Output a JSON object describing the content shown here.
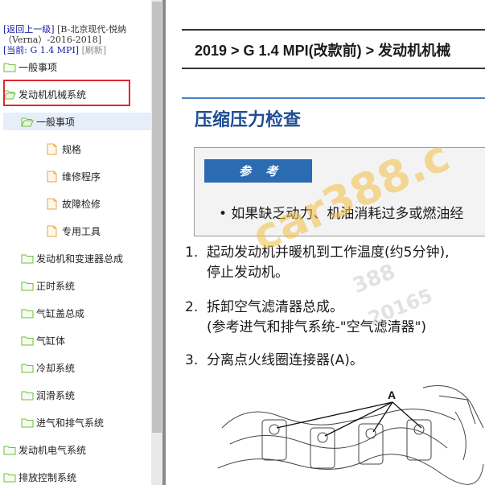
{
  "sidebar": {
    "header": {
      "back_link": "[返回上一级]",
      "model_line": "[B-北京现代-悦纳（Verna）-2016-2018]",
      "current_label": "[当前:",
      "current_value": "G 1.4 MPI]",
      "refresh": "[刷新]"
    },
    "tree": [
      {
        "label": "一般事项",
        "icon": "folder-icon"
      },
      {
        "label": "发动机机械系统",
        "icon": "folder-open-icon"
      },
      {
        "label": "一般事项",
        "icon": "folder-open-icon"
      },
      {
        "label": "规格",
        "icon": "page-icon"
      },
      {
        "label": "维修程序",
        "icon": "page-icon"
      },
      {
        "label": "故障检修",
        "icon": "page-icon"
      },
      {
        "label": "专用工具",
        "icon": "page-icon"
      },
      {
        "label": "发动机和变速器总成",
        "icon": "folder-icon"
      },
      {
        "label": "正时系统",
        "icon": "folder-icon"
      },
      {
        "label": "气缸盖总成",
        "icon": "folder-icon"
      },
      {
        "label": "气缸体",
        "icon": "folder-icon"
      },
      {
        "label": "冷却系统",
        "icon": "folder-icon"
      },
      {
        "label": "润滑系统",
        "icon": "folder-icon"
      },
      {
        "label": "进气和排气系统",
        "icon": "folder-icon"
      },
      {
        "label": "发动机电气系统",
        "icon": "folder-icon"
      },
      {
        "label": "排放控制系统",
        "icon": "folder-icon"
      }
    ]
  },
  "content": {
    "breadcrumb": "2019 > G 1.4 MPI(改款前) > 发动机机械",
    "title": "压缩压力检查",
    "note_button": "参考",
    "note_text": "• 如果缺乏动力、机油消耗过多或燃油经",
    "steps": [
      {
        "number": "1.",
        "line1": "起动发动机并暖机到工作温度(约5分钟),",
        "line2": "停止发动机。"
      },
      {
        "number": "2.",
        "line1": "拆卸空气滤清器总成。",
        "line2": "(参考进气和排气系统-\"空气滤清器\")"
      },
      {
        "number": "3.",
        "line1": "分离点火线圈连接器(A)。",
        "line2": ""
      }
    ],
    "figure_label": "A"
  },
  "watermark": {
    "main": "car388.c",
    "sub1": "388",
    "sub2": "20165"
  },
  "colors": {
    "link": "#1a1aa6",
    "title_blue": "#1f4e93",
    "note_button": "#2b6bb2",
    "highlight_box": "#e0282e",
    "folder": "#6fbf3a",
    "page": "#e8a64a"
  }
}
